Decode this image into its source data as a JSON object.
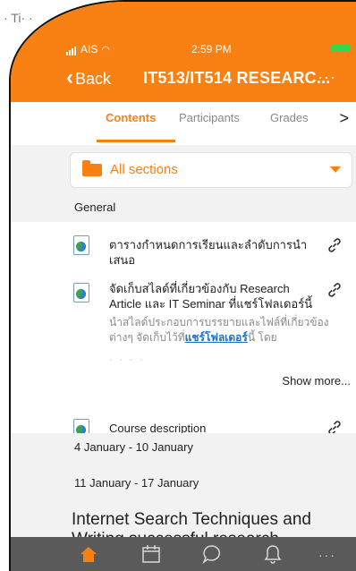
{
  "status_bar": {
    "carrier": "AIS",
    "time": "2:59 PM"
  },
  "nav": {
    "back_label": "Back",
    "title": "IT513/IT514 RESEARC...",
    "more_label": "···"
  },
  "tabs": [
    {
      "label": "Contents",
      "active": true
    },
    {
      "label": "Participants",
      "active": false
    },
    {
      "label": "Grades",
      "active": false
    }
  ],
  "tabs_next": ">",
  "section_selector": {
    "label": "All sections"
  },
  "sections": {
    "general": "General",
    "week1": "4 January - 10 January",
    "week2": "11 January - 17 January"
  },
  "items": {
    "item1": {
      "title": "ตารางกำหนดการเรียนและลำดับการนำเสนอ"
    },
    "item2": {
      "title": "จัดเก็บสไลด์ที่เกี่ยวข้องกับ Research Article และ IT Seminar ที่แชร์โฟลเดอร์นี้",
      "desc_pre": "นำสไลด์ประกอบการบรรยายและไฟล์ที่เกี่ยวข้องต่างๆ จัดเก็บไว้ที่",
      "desc_link": "แชร์โฟลเดอร์",
      "desc_post": "นี้ โดย",
      "show_more": "Show more..."
    },
    "item3": {
      "title": "Course description"
    }
  },
  "topic_heading": "Internet Search Techniques and Writing successful research",
  "bottom_bar": {
    "more": "···"
  },
  "colors": {
    "accent": "#f98012",
    "link": "#1e70c3",
    "bottom_bar": "#5a5a5a"
  }
}
